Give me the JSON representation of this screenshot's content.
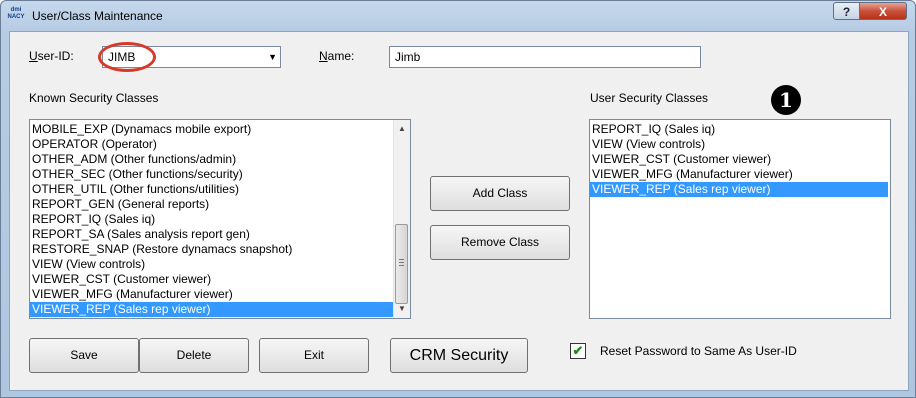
{
  "window": {
    "title": "User/Class Maintenance",
    "app_icon_text": "dmi NACY",
    "help_label": "?",
    "close_label": "X"
  },
  "user": {
    "label": "User-ID:",
    "value": "JIMB",
    "dropdown_icon": "▼"
  },
  "name": {
    "label": "Name:",
    "value": "Jimb"
  },
  "known": {
    "label": "Known Security Classes",
    "items": [
      "MOBILE_EXP (Dynamacs mobile export)",
      "OPERATOR (Operator)",
      "OTHER_ADM (Other functions/admin)",
      "OTHER_SEC (Other functions/security)",
      "OTHER_UTIL (Other functions/utilities)",
      "REPORT_GEN (General reports)",
      "REPORT_IQ (Sales iq)",
      "REPORT_SA (Sales analysis report gen)",
      "RESTORE_SNAP (Restore dynamacs snapshot)",
      "VIEW (View controls)",
      "VIEWER_CST (Customer viewer)",
      "VIEWER_MFG (Manufacturer viewer)",
      "VIEWER_REP (Sales rep viewer)"
    ],
    "selected_index": 12,
    "scroll_up": "▲",
    "scroll_down": "▼"
  },
  "user_classes": {
    "label": "User Security Classes",
    "items": [
      "REPORT_IQ (Sales iq)",
      "VIEW (View controls)",
      "VIEWER_CST (Customer viewer)",
      "VIEWER_MFG (Manufacturer viewer)",
      "VIEWER_REP (Sales rep viewer)"
    ],
    "selected_index": 4
  },
  "annotation_badge": "1",
  "buttons": {
    "add_class": "Add Class",
    "remove_class": "Remove Class",
    "save": "Save",
    "delete": "Delete",
    "exit": "Exit",
    "crm_security": "CRM Security"
  },
  "reset_password": {
    "label": "Reset Password to Same As User-ID",
    "checked": true,
    "check_glyph": "✔"
  },
  "colors": {
    "selection": "#3399ff",
    "highlight_circle": "#d63a2a",
    "title_gradient": "#c5d8ec",
    "close_button": "#c9503a"
  }
}
